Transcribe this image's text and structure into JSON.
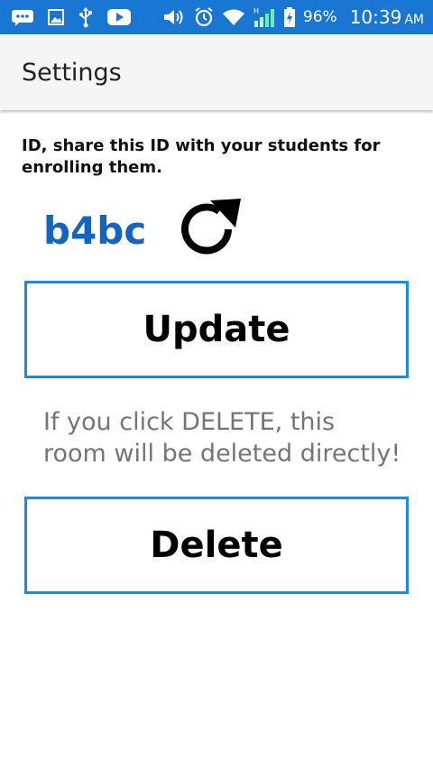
{
  "status_bar": {
    "battery": "96%",
    "time": "10:39",
    "ampm": "AM",
    "icons": [
      "message-icon",
      "image-icon",
      "usb-icon",
      "youtube-icon",
      "volume-icon",
      "alarm-icon",
      "wifi-icon",
      "signal-icon",
      "battery-icon"
    ],
    "background_color": "#1976d2"
  },
  "app_bar": {
    "title": "Settings"
  },
  "content": {
    "id_label": "ID, share this ID with your students for enrolling them.",
    "room_id": "b4bc",
    "room_id_color": "#1565c0",
    "refresh_icon": "refresh-icon",
    "update_label": "Update",
    "warning": "If you click DELETE, this room will be deleted directly!",
    "delete_label": "Delete",
    "button_border_color": "#1e88e5"
  }
}
